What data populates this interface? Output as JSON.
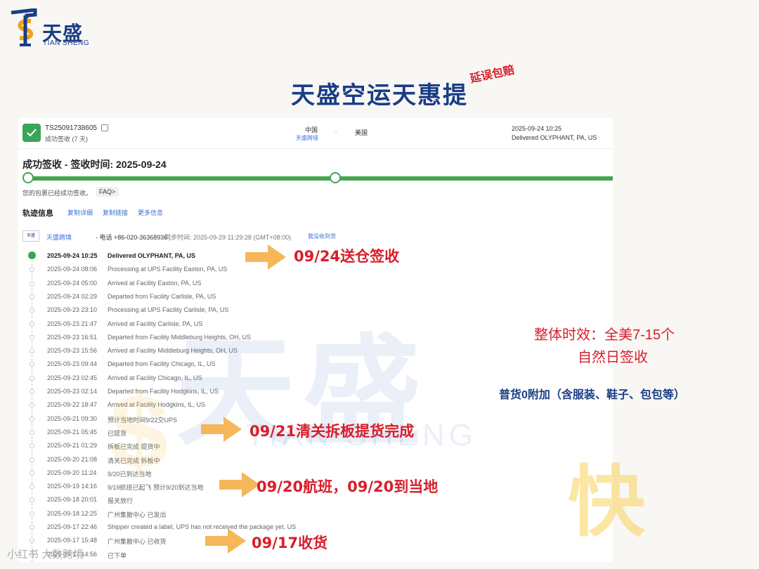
{
  "logo": {
    "cn": "天盛",
    "en": "TIAN SHENG"
  },
  "headline": {
    "title": "天盛空运天惠提",
    "tag": "延误包赔"
  },
  "header": {
    "tracking_no": "TS25091738605",
    "status_sub": "成功签收 (7 天)",
    "origin": "中国",
    "origin_carrier": "天盛跨境",
    "dest": "美国",
    "delivered_time": "2025-09-24 10:25",
    "delivered_loc": "Delivered OLYPHANT, PA, US"
  },
  "status": {
    "title": "成功签收 - 签收时间: 2025-09-24",
    "progress": 1.0,
    "notice": "您的包裹已经成功签收。",
    "faq": "FAQ>"
  },
  "tabs": {
    "title": "轨迹信息",
    "links": [
      "复制详细",
      "复制链接",
      "更多信息"
    ]
  },
  "carrier": {
    "logo_text": "天盛",
    "name": "天盛跨境",
    "phone": "- 电话 +86-020-36368936",
    "sync": "同步时间: 2025-09-29 11:29:28 (GMT+08:00)",
    "link": "我没收到货"
  },
  "events": [
    {
      "time": "2025-09-24 10:25",
      "desc": "Delivered OLYPHANT, PA, US"
    },
    {
      "time": "2025-09-24 08:06",
      "desc": "Processing at UPS Facility Easton, PA, US"
    },
    {
      "time": "2025-09-24 05:00",
      "desc": "Arrived at Facility Easton, PA, US"
    },
    {
      "time": "2025-09-24 02:29",
      "desc": "Departed from Facility Carlisle, PA, US"
    },
    {
      "time": "2025-09-23 23:10",
      "desc": "Processing at UPS Facility Carlisle, PA, US"
    },
    {
      "time": "2025-09-23 21:47",
      "desc": "Arrived at Facility Carlisle, PA, US"
    },
    {
      "time": "2025-09-23 16:51",
      "desc": "Departed from Facility Middleburg Heights, OH, US"
    },
    {
      "time": "2025-09-23 15:56",
      "desc": "Arrived at Facility Middleburg Heights, OH, US"
    },
    {
      "time": "2025-09-23 09:44",
      "desc": "Departed from Facility Chicago, IL, US"
    },
    {
      "time": "2025-09-23 02:45",
      "desc": "Arrived at Facility Chicago, IL, US"
    },
    {
      "time": "2025-09-23 02:14",
      "desc": "Departed from Facility Hodgkins, IL, US"
    },
    {
      "time": "2025-09-22 18:47",
      "desc": "Arrived at Facility Hodgkins, IL, US"
    },
    {
      "time": "2025-09-21 09:30",
      "desc": "预计当地时间9/22交UPS"
    },
    {
      "time": "2025-09-21 05:45",
      "desc": "已提货"
    },
    {
      "time": "2025-09-21 01:29",
      "desc": "拆板已完成 提货中"
    },
    {
      "time": "2025-09-20 21:08",
      "desc": "清关已完成 拆板中"
    },
    {
      "time": "2025-09-20 11:24",
      "desc": "9/20已到达当地"
    },
    {
      "time": "2025-09-19 14:16",
      "desc": "9/19航班已起飞 预计9/20到达当地"
    },
    {
      "time": "2025-09-18 20:01",
      "desc": "报关放行"
    },
    {
      "time": "2025-09-18 12:25",
      "desc": "广州集散中心 已发出"
    },
    {
      "time": "2025-09-17 22:46",
      "desc": "Shipper created a label, UPS has not received the package yet. US"
    },
    {
      "time": "2025-09-17 15:48",
      "desc": "广州集散中心 已收货"
    },
    {
      "time": "2025-09-17 14:56",
      "desc": "已下单"
    }
  ],
  "callouts": [
    "09/24送仓签收",
    "09/21清关拆板提货完成",
    "09/20航班，09/20到当地",
    "09/17收货"
  ],
  "side_notes": {
    "line1": "整体时效：全美7-15个",
    "line2": "自然日签收",
    "line3": "普货0附加（含服装、鞋子、包包等）",
    "kuai": "快"
  },
  "watermark": {
    "big": "天盛",
    "en": "TIAN SHENG"
  },
  "footer": "小红书 大数跨境"
}
